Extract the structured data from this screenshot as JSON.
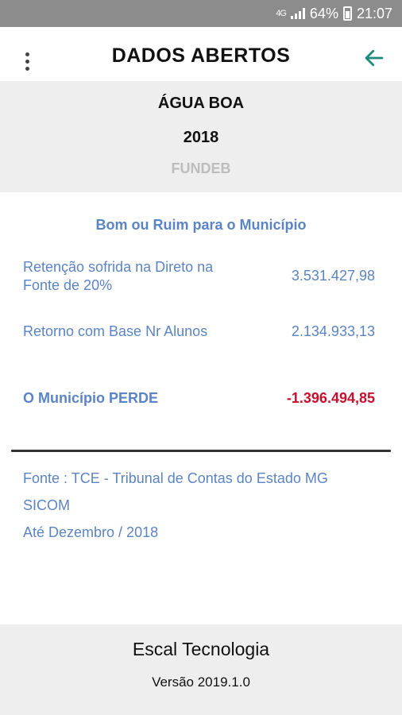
{
  "status_bar": {
    "network": "4G",
    "battery": "64%",
    "time": "21:07"
  },
  "app_bar": {
    "title": "DADOS ABERTOS",
    "menu_icon": "more-vert-icon",
    "back_icon": "arrow-back-icon",
    "accent": "#1a8a7a"
  },
  "header": {
    "city": "ÁGUA BOA",
    "year": "2018",
    "fund": "FUNDEB"
  },
  "summary": {
    "title": "Bom ou Ruim para o Município",
    "rows": [
      {
        "label": "Retenção sofrida na Direto na Fonte de 20%",
        "value": "3.531.427,98"
      },
      {
        "label": "Retorno com Base Nr Alunos",
        "value": "2.134.933,13"
      },
      {
        "label": "O Município PERDE",
        "value": "-1.396.494,85"
      }
    ]
  },
  "source": {
    "line1": "Fonte : TCE - Tribunal de Contas do Estado MG",
    "line2": "SICOM",
    "line3": "Até Dezembro / 2018"
  },
  "footer": {
    "company": "Escal Tecnologia",
    "version": "Versão 2019.1.0"
  },
  "colors": {
    "label_blue": "#5b84c4",
    "loss_red": "#c8102e",
    "panel_gray": "#eeeeee",
    "status_gray": "#8c8c8c"
  }
}
